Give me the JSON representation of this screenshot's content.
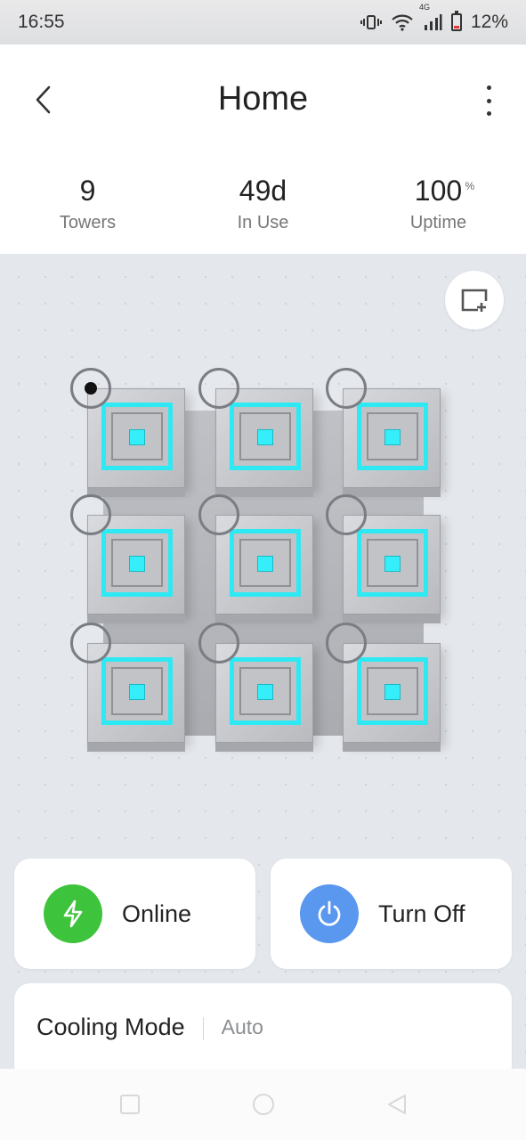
{
  "status_bar": {
    "time": "16:55",
    "network_label": "4G",
    "battery": "12%",
    "icons": [
      "vibrate-icon",
      "wifi-icon",
      "signal-icon",
      "battery-icon"
    ]
  },
  "header": {
    "title": "Home",
    "back_icon": "chevron-left-icon",
    "menu_icon": "more-vertical-icon"
  },
  "stats": [
    {
      "value": "9",
      "unit": "",
      "label": "Towers"
    },
    {
      "value": "49d",
      "unit": "",
      "label": "In Use"
    },
    {
      "value": "100",
      "unit": "%",
      "label": "Uptime"
    }
  ],
  "main": {
    "add_view_icon": "add-window-icon",
    "towers": {
      "rows": 3,
      "cols": 3,
      "selected_index": 0,
      "led_color": "#2de9f4"
    }
  },
  "cards": {
    "online": {
      "label": "Online",
      "icon": "bolt-icon",
      "color": "#3ec33c"
    },
    "turn_off": {
      "label": "Turn Off",
      "icon": "power-icon",
      "color": "#5a97ee"
    },
    "cooling": {
      "title": "Cooling Mode",
      "value": "Auto"
    }
  },
  "nav": {
    "icons": [
      "square-icon",
      "circle-icon",
      "triangle-back-icon"
    ]
  }
}
